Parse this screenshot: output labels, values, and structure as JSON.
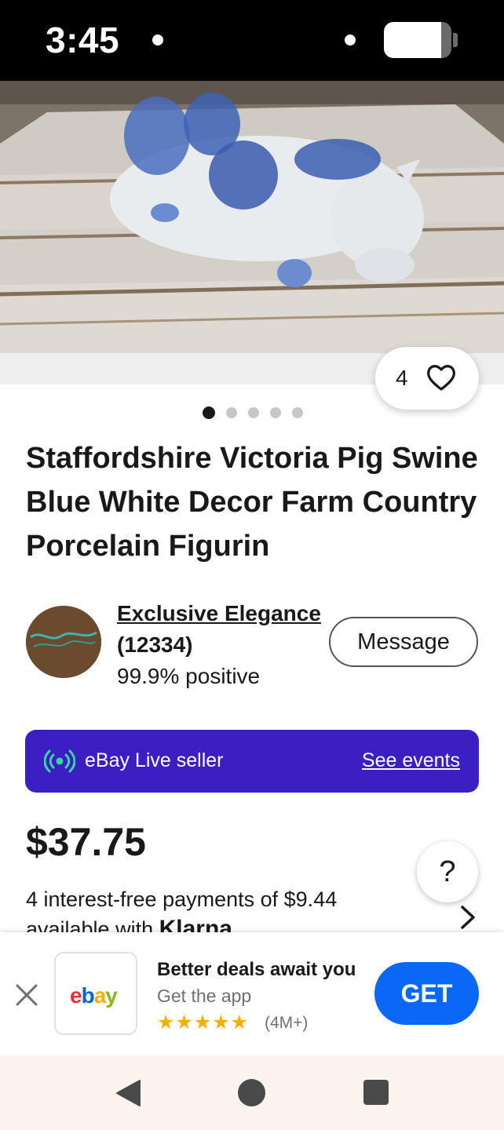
{
  "status_bar": {
    "time": "3:45",
    "battery_level": 0.85
  },
  "listing": {
    "watch_count": "4",
    "image_count": 5,
    "active_image_index": 0,
    "title": "Staffordshire Victoria Pig Swine Blue White Decor Farm Country Porcelain Figurin"
  },
  "seller": {
    "name": "Exclusive Elegance",
    "feedback_count": "(12334)",
    "positive": "99.9% positive",
    "message_label": "Message"
  },
  "live_banner": {
    "label": "eBay Live seller",
    "link": "See events",
    "color": "#3b1fc2"
  },
  "price": {
    "amount": "$37.75",
    "installments_line1": "4 interest-free payments of $9.44",
    "installments_line2_prefix": "available with ",
    "provider": "Klarna",
    "help_label": "?"
  },
  "app_banner": {
    "brand": "ebay",
    "title": "Better deals await you",
    "subtitle": "Get the app",
    "stars": "★★★★★",
    "rating_count": "(4M+)",
    "get_label": "GET",
    "accent": "#0968f6"
  },
  "icons": [
    "heart-icon",
    "live-broadcast-icon",
    "chevron-right-icon",
    "close-icon",
    "back-icon",
    "home-icon",
    "recents-icon"
  ]
}
